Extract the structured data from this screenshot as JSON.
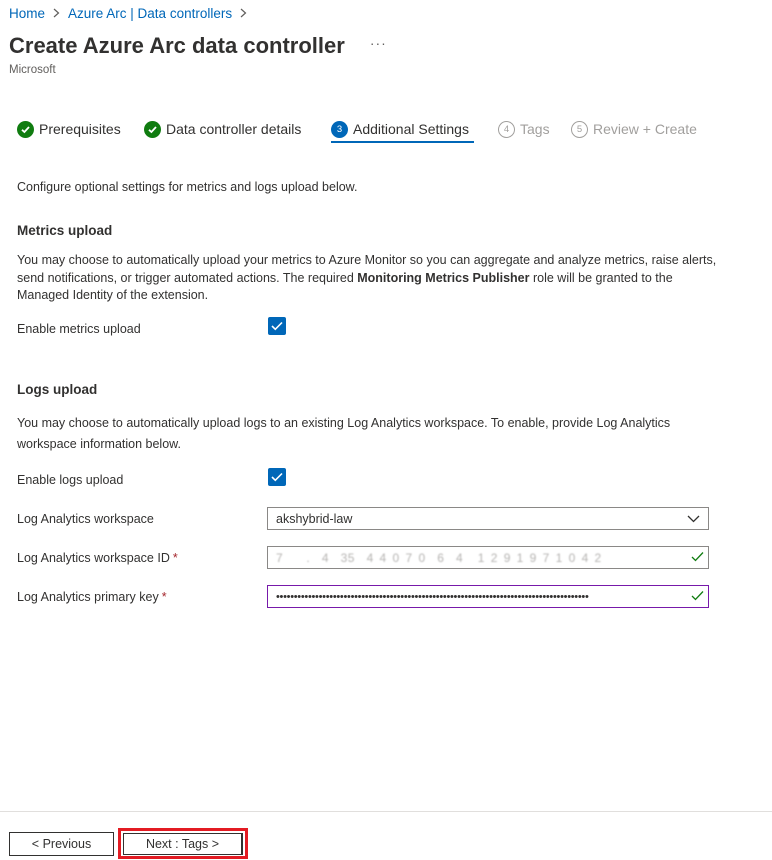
{
  "breadcrumb": {
    "home": "Home",
    "sep": ">",
    "parent": "Azure Arc | Data controllers"
  },
  "header": {
    "title": "Create Azure Arc data controller",
    "more": "···",
    "publisher": "Microsoft"
  },
  "tabs": [
    {
      "label": "Prerequisites",
      "state": "complete"
    },
    {
      "label": "Data controller details",
      "state": "complete"
    },
    {
      "label": "Additional Settings",
      "number": "3",
      "state": "active"
    },
    {
      "label": "Tags",
      "number": "4",
      "state": "disabled"
    },
    {
      "label": "Review + Create",
      "number": "5",
      "state": "disabled"
    }
  ],
  "intro": "Configure optional settings for metrics and logs upload below.",
  "metrics": {
    "heading": "Metrics upload",
    "desc_before": "You may choose to automatically upload your metrics to Azure Monitor so you can aggregate and analyze metrics, raise alerts, send notifications, or trigger automated actions. The required ",
    "desc_bold": "Monitoring Metrics Publisher",
    "desc_after": " role will be granted to the Managed Identity of the extension.",
    "enable_label": "Enable metrics upload",
    "enabled": true
  },
  "logs": {
    "heading": "Logs upload",
    "desc": "You may choose to automatically upload logs to an existing Log Analytics workspace. To enable, provide Log Analytics workspace information below.",
    "enable_label": "Enable logs upload",
    "enabled": true,
    "workspace_label": "Log Analytics workspace",
    "workspace_value": "akshybrid-law",
    "workspace_id_label": "Log Analytics workspace ID",
    "workspace_id_required": "*",
    "workspace_id_value": "7        .    4    35    4  4  0  7  0    6    4     1  2  9  1  9  7  1  0  4  2",
    "primary_key_label": "Log Analytics primary key",
    "primary_key_required": "*",
    "primary_key_value": "••••••••••••••••••••••••••••••••••••••••••••••••••••••••••••••••••••••••••••••••••••••••"
  },
  "footer": {
    "previous": "< Previous",
    "next": "Next : Tags >"
  },
  "colors": {
    "accent": "#0067b8",
    "success": "#107c10",
    "highlight": "#e31b23",
    "required": "#a4262c"
  }
}
